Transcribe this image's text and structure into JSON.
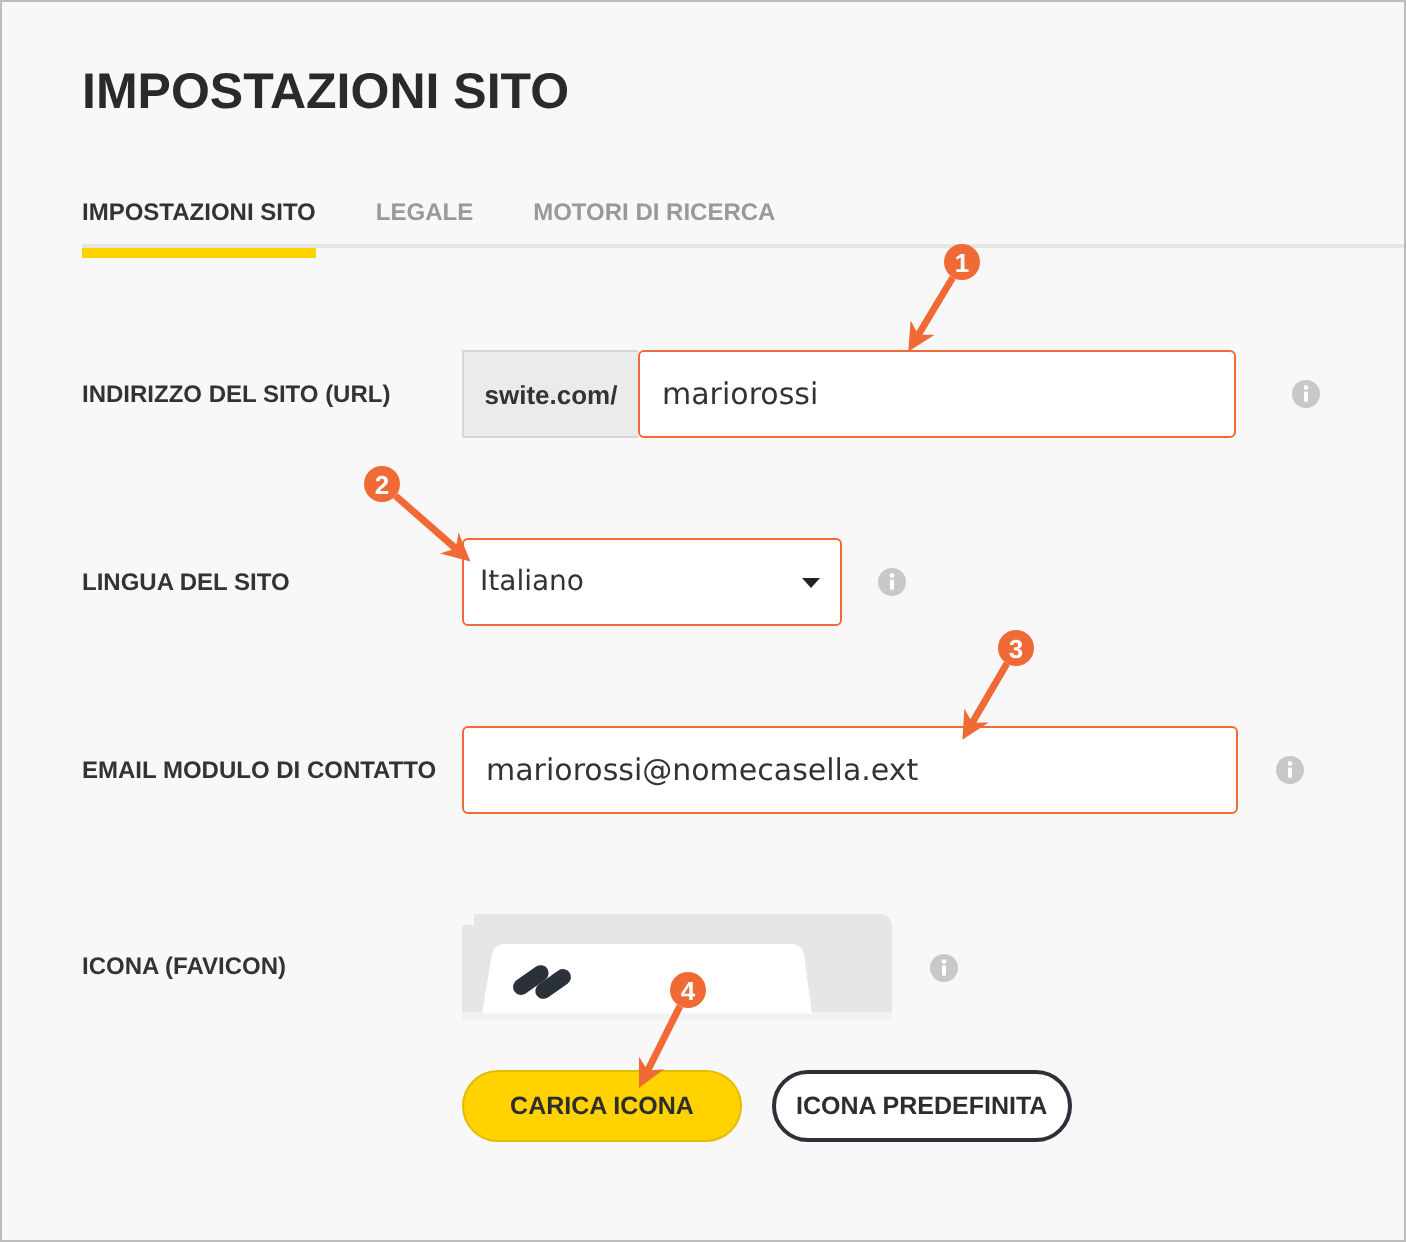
{
  "title": "IMPOSTAZIONI SITO",
  "tabs": [
    {
      "label": "IMPOSTAZIONI SITO",
      "selected": true
    },
    {
      "label": "LEGALE",
      "selected": false
    },
    {
      "label": "MOTORI DI RICERCA",
      "selected": false
    }
  ],
  "fields": [
    {
      "kind": "url",
      "label": "INDIRIZZO DEL SITO (URL)",
      "prefix": "swite.com/",
      "value": "mariorossi"
    },
    {
      "kind": "select",
      "label": "LINGUA DEL SITO",
      "value": "Italiano"
    },
    {
      "kind": "text",
      "label": "EMAIL MODULO DI CONTATTO",
      "value": "mariorossi@nomecasella.ext"
    },
    {
      "kind": "favicon",
      "label": "ICONA (FAVICON)"
    }
  ],
  "buttons": [
    {
      "kind": "primary",
      "label": "CARICA ICONA"
    },
    {
      "kind": "secondary",
      "label": "ICONA PREDEFINITA"
    }
  ],
  "callouts": [
    {
      "label": "1"
    },
    {
      "label": "2"
    },
    {
      "label": "3"
    },
    {
      "label": "4"
    }
  ]
}
